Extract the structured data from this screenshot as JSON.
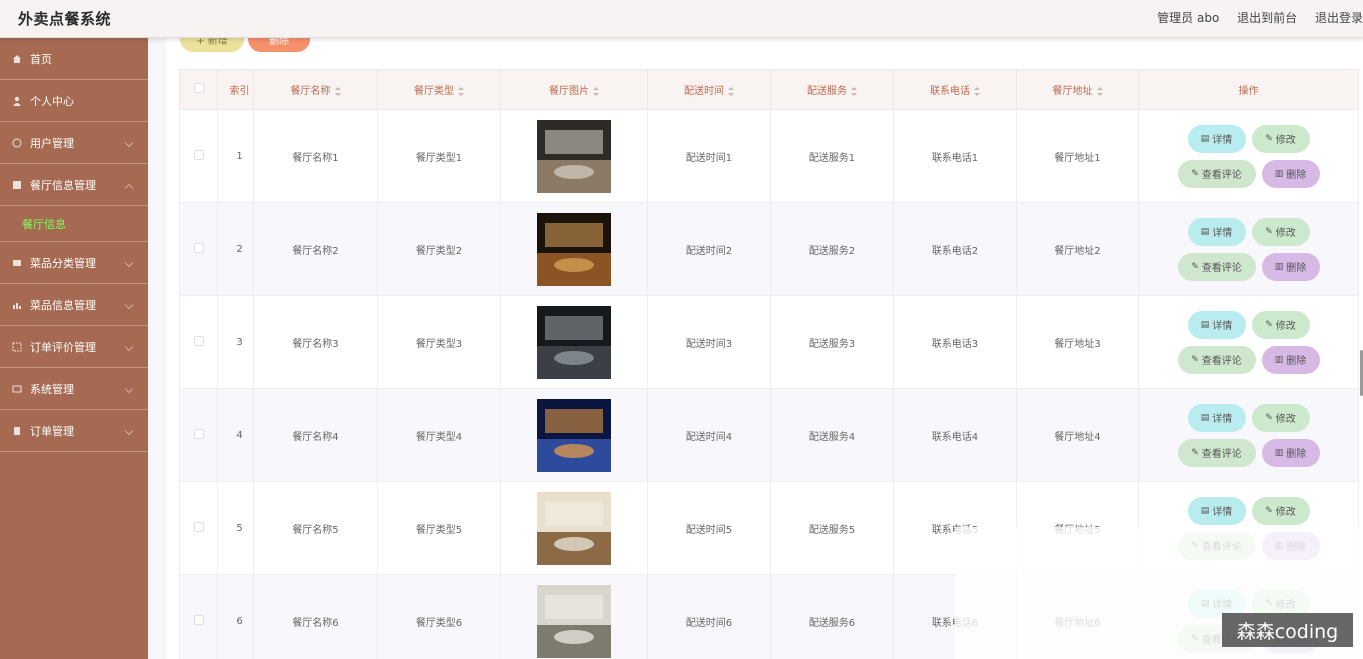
{
  "header": {
    "title": "外卖点餐系统",
    "admin_label": "管理员 abo",
    "front_link": "退出到前台",
    "logout_link": "退出登录"
  },
  "sidebar": {
    "items": [
      {
        "label": "首页",
        "icon": "home-icon"
      },
      {
        "label": "个人中心",
        "icon": "user-icon"
      },
      {
        "label": "用户管理",
        "icon": "users-icon"
      },
      {
        "label": "餐厅信息管理",
        "icon": "store-icon"
      },
      {
        "label": "菜品分类管理",
        "icon": "category-icon"
      },
      {
        "label": "菜品信息管理",
        "icon": "dish-icon"
      },
      {
        "label": "订单评价管理",
        "icon": "review-icon"
      },
      {
        "label": "系统管理",
        "icon": "system-icon"
      },
      {
        "label": "订单管理",
        "icon": "order-icon"
      }
    ],
    "submenu": "餐厅信息",
    "active_color": "#7dff5c"
  },
  "toolbar": {
    "add_label": "+ 新增",
    "delete_label": "删除"
  },
  "table": {
    "columns": [
      "索引",
      "餐厅名称",
      "餐厅类型",
      "餐厅图片",
      "配送时间",
      "配送服务",
      "联系电话",
      "餐厅地址",
      "操作"
    ],
    "rows": [
      {
        "idx": "1",
        "name": "餐厅名称1",
        "type": "餐厅类型1",
        "time": "配送时间1",
        "service": "配送服务1",
        "phone": "联系电话1",
        "addr": "餐厅地址1"
      },
      {
        "idx": "2",
        "name": "餐厅名称2",
        "type": "餐厅类型2",
        "time": "配送时间2",
        "service": "配送服务2",
        "phone": "联系电话2",
        "addr": "餐厅地址2"
      },
      {
        "idx": "3",
        "name": "餐厅名称3",
        "type": "餐厅类型3",
        "time": "配送时间3",
        "service": "配送服务3",
        "phone": "联系电话3",
        "addr": "餐厅地址3"
      },
      {
        "idx": "4",
        "name": "餐厅名称4",
        "type": "餐厅类型4",
        "time": "配送时间4",
        "service": "配送服务4",
        "phone": "联系电话4",
        "addr": "餐厅地址4"
      },
      {
        "idx": "5",
        "name": "餐厅名称5",
        "type": "餐厅类型5",
        "time": "配送时间5",
        "service": "配送服务5",
        "phone": "联系电话5",
        "addr": "餐厅地址5"
      },
      {
        "idx": "6",
        "name": "餐厅名称6",
        "type": "餐厅类型6",
        "time": "配送时间6",
        "service": "配送服务6",
        "phone": "联系电话6",
        "addr": "餐厅地址6"
      }
    ],
    "actions": {
      "detail": "详情",
      "edit": "修改",
      "review": "查看评论",
      "remove": "删除"
    }
  },
  "watermark": "森森coding"
}
